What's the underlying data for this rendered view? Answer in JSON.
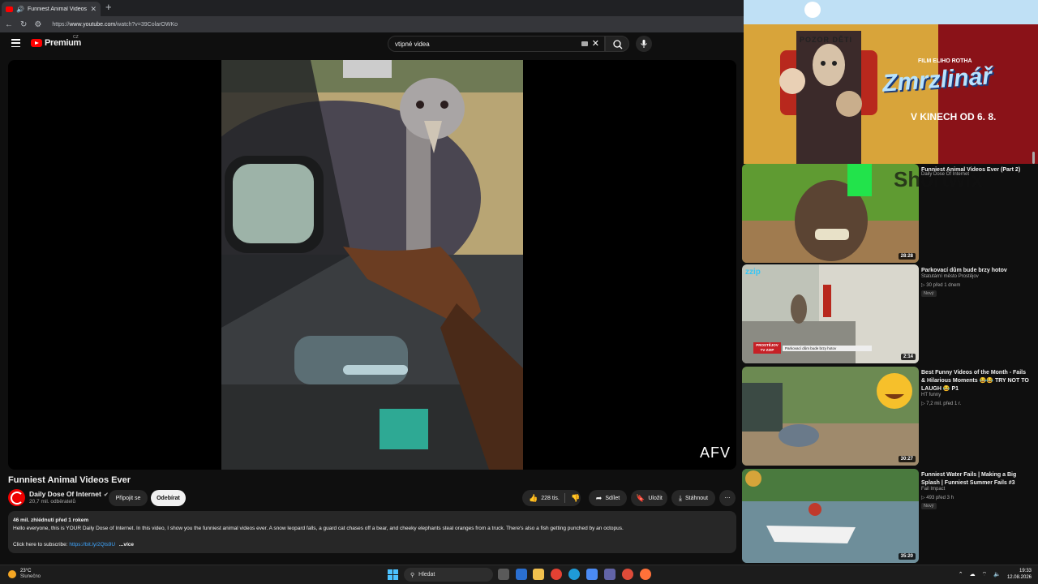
{
  "browser": {
    "tab_title": "Funniest Animal Videos Ever",
    "tab_close": "✕",
    "new_tab": "+",
    "url_prefix": "https://",
    "url_domain": "www.youtube.com",
    "url_path": "/watch?v=39ColarOWKo"
  },
  "header": {
    "logo_text": "Premium",
    "region": "CZ",
    "search_value": "vtipné videa"
  },
  "player": {
    "watermark": "AFV"
  },
  "video": {
    "title": "Funniest Animal Videos Ever",
    "channel_name": "Daily Dose Of Internet",
    "subscribers": "20,7 mil. odběratelů",
    "join_label": "Připojit se",
    "subscribe_label": "Odebírat",
    "likes": "228 tis.",
    "share_label": "Sdílet",
    "save_label": "Uložit",
    "download_label": "Stáhnout",
    "more_label": "⋯"
  },
  "description": {
    "meta": "46 mil. zhlédnutí  před 1 rokem",
    "text": "Hello everyone, this is YOUR Daily Dose of Internet. In this video, I show you the funniest animal videos ever. A snow leopard falls, a guard cat chases off a bear, and cheeky elephants steal oranges from a truck. There's also a fish getting punched by an octopus.",
    "subscribe_prefix": "Click here to subscribe:",
    "subscribe_link": "https://bit.ly/2Qts9U",
    "more": "...více"
  },
  "ad": {
    "pozor": "POZOR DĚTI",
    "prefix": "FILM ELIHO ROTHA",
    "title": "Zmrzlinář",
    "date": "V KINECH OD 6. 8."
  },
  "recommendations": [
    {
      "title": "Funniest Animal Videos Ever (Part 2)",
      "channel": "Daily Dose Of Internet",
      "views": "",
      "badge": "",
      "duration": "28:28",
      "overlay": "Shortwix"
    },
    {
      "title": "Parkovací dům bude brzy hotov",
      "channel": "Statutární město Prostějov",
      "views": "▷ 30  před 1 dnem",
      "badge": "Nový",
      "duration": "2:14",
      "overlay": "zzip",
      "tag1": "PROSTĚJOV TV ZZIP",
      "tag2": "Parkovací dům bude brzy hotov"
    },
    {
      "title": "Best Funny Videos of the Month - Fails & Hilarious Moments 😂😂 TRY NOT TO LAUGH 😂 P1",
      "channel": "HT funny",
      "views": "▷ 7,2 mil.  před 1 r.",
      "badge": "",
      "duration": "30:27"
    },
    {
      "title": "Funniest Water Fails | Making a Big Splash | Funniest Summer Fails #3",
      "channel": "Fail Impact",
      "views": "▷ 493  před 3 h",
      "badge": "Nový",
      "duration": "35:20"
    }
  ],
  "taskbar": {
    "temp": "23°C",
    "weather": "Slunečno",
    "search_label": "Hledat",
    "time": "19:33",
    "date": "12.08.2026"
  },
  "colors": {
    "accent_red": "#ff0000",
    "link": "#3ea6ff",
    "bg": "#0f0f0f"
  }
}
